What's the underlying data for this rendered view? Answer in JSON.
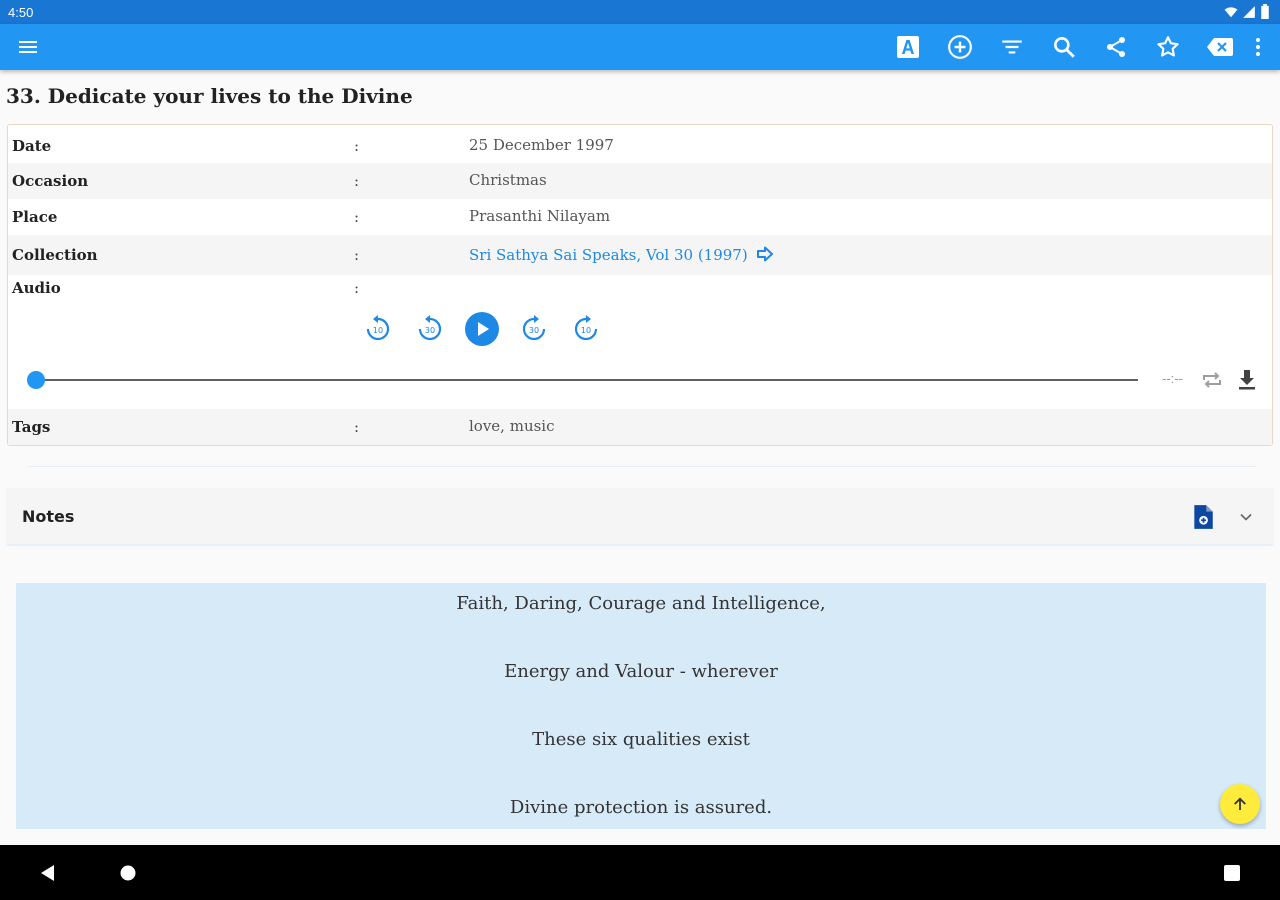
{
  "status_bar": {
    "time": "4:50"
  },
  "toolbar": {
    "icons": [
      "menu-icon",
      "font-size-icon",
      "add-circle-icon",
      "filter-icon",
      "search-icon",
      "share-icon",
      "star-icon",
      "clear-icon",
      "more-vert-icon"
    ]
  },
  "discourse": {
    "title": "33. Dedicate your lives to the Divine"
  },
  "details": [
    {
      "label": "Date",
      "colon": ":",
      "value": "25 December 1997"
    },
    {
      "label": "Occasion",
      "colon": ":",
      "value": "Christmas"
    },
    {
      "label": "Place",
      "colon": ":",
      "value": "Prasanthi Nilayam"
    },
    {
      "label": "Collection",
      "colon": ":",
      "value": "Sri Sathya Sai Speaks, Vol 30 (1997)"
    },
    {
      "label": "Audio",
      "colon": ":"
    },
    {
      "label": "Tags",
      "colon": ":",
      "value": "love, music"
    }
  ],
  "audio": {
    "skip_labels": [
      "10",
      "30",
      "30",
      "10"
    ],
    "time": "--:--",
    "progress": 0
  },
  "notes": {
    "label": "Notes"
  },
  "quote": {
    "lines": [
      "Faith, Daring, Courage and Intelligence,",
      "Energy and Valour - wherever",
      "These six qualities exist",
      "Divine protection is assured."
    ]
  },
  "colors": {
    "primary": "#2196F3",
    "accent": "#FFEB3B",
    "link": "#1E88E5",
    "quote_bg": "#d6eaf8"
  }
}
